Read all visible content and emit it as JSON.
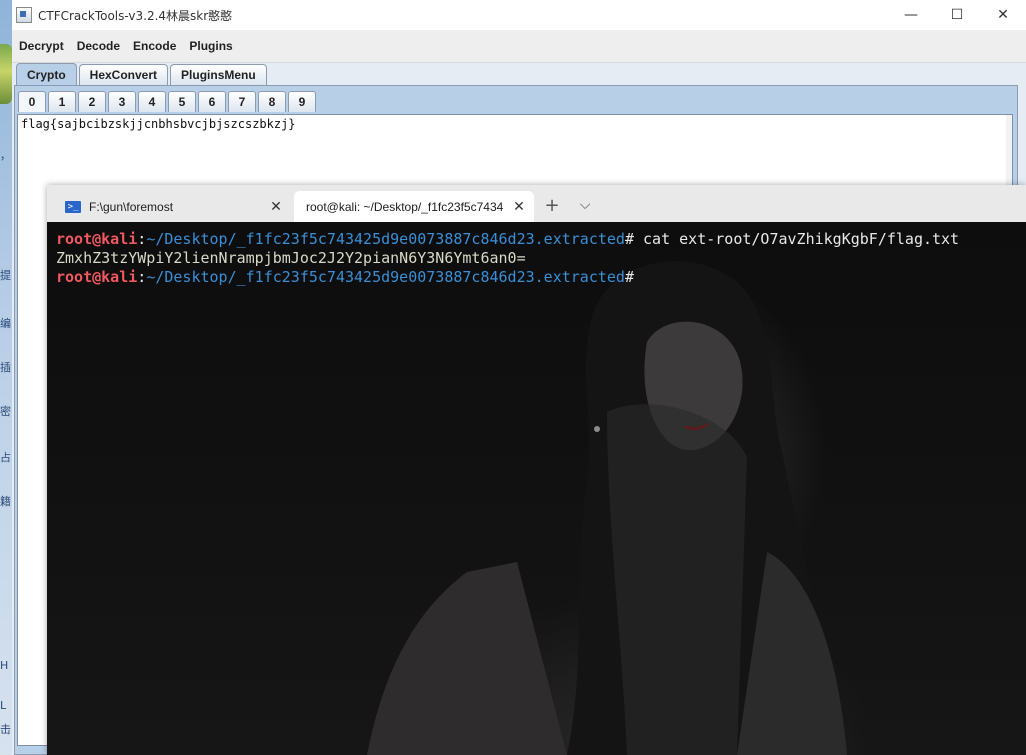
{
  "desktop": {
    "side_chars": [
      "，",
      "提",
      "编",
      "插",
      "密",
      "占",
      "籍",
      "H",
      "L",
      "击"
    ]
  },
  "java_app": {
    "title": "CTFCrackTools-v3.2.4林晨skr憨憨",
    "window_controls": [
      "—",
      "☐",
      "✕"
    ],
    "menu": [
      "Decrypt",
      "Decode",
      "Encode",
      "Plugins"
    ],
    "tabs": [
      "Crypto",
      "HexConvert",
      "PluginsMenu"
    ],
    "sub_tabs": [
      "0",
      "1",
      "2",
      "3",
      "4",
      "5",
      "6",
      "7",
      "8",
      "9"
    ],
    "text_content": "flag{sajbcibzskjjcnbhsbvcjbjszcszbkzj}"
  },
  "terminal": {
    "tabs": [
      {
        "title": "F:\\gun\\foremost",
        "close": "✕"
      },
      {
        "title": "root@kali: ~/Desktop/_f1fc23f5c7434",
        "close": "✕"
      }
    ],
    "new_tab": "+",
    "dropdown": "⌵",
    "prompt_user": "root@kali",
    "prompt_sep": ":",
    "prompt_path": "~/Desktop/_f1fc23f5c743425d9e0073887c846d23.extracted",
    "prompt_end": "#",
    "command": " cat ext-root/O7avZhikgKgbF/flag.txt",
    "output": "ZmxhZ3tzYWpiY2lienNrampjbmJoc2J2Y2pianN6Y3N6Ymt6an0="
  }
}
